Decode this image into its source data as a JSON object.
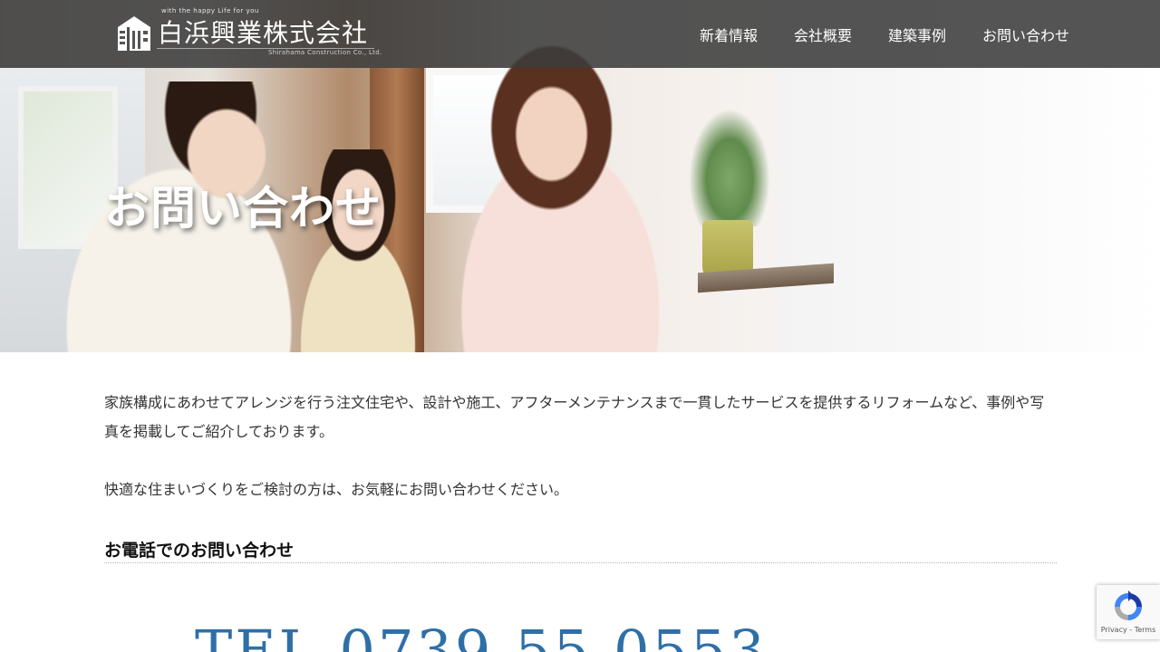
{
  "header": {
    "logo_text": "白浜興業株式会社",
    "logo_tagline": "with the happy Life for you",
    "logo_sub": "Shirahama Construction Co., Ltd.",
    "nav": [
      {
        "label": "新着情報"
      },
      {
        "label": "会社概要"
      },
      {
        "label": "建築事例"
      },
      {
        "label": "お問い合わせ"
      }
    ]
  },
  "hero": {
    "title": "お問い合わせ"
  },
  "main": {
    "intro": "家族構成にあわせてアレンジを行う注文住宅や、設計や施工、アフターメンテナンスまで一貫したサービスを提供するリフォームなど、事例や写真を掲載してご紹介しております。",
    "intro2": "快適な住まいづくりをご検討の方は、お気軽にお問い合わせください。",
    "phone_heading": "お電話でのお問い合わせ",
    "tel": "TEL 0739-55-0553"
  },
  "recaptcha": {
    "links": "Privacy - Terms"
  },
  "colors": {
    "header_bg": "#3c3c3c",
    "tel_color": "#2f6fa8",
    "text": "#333333"
  }
}
